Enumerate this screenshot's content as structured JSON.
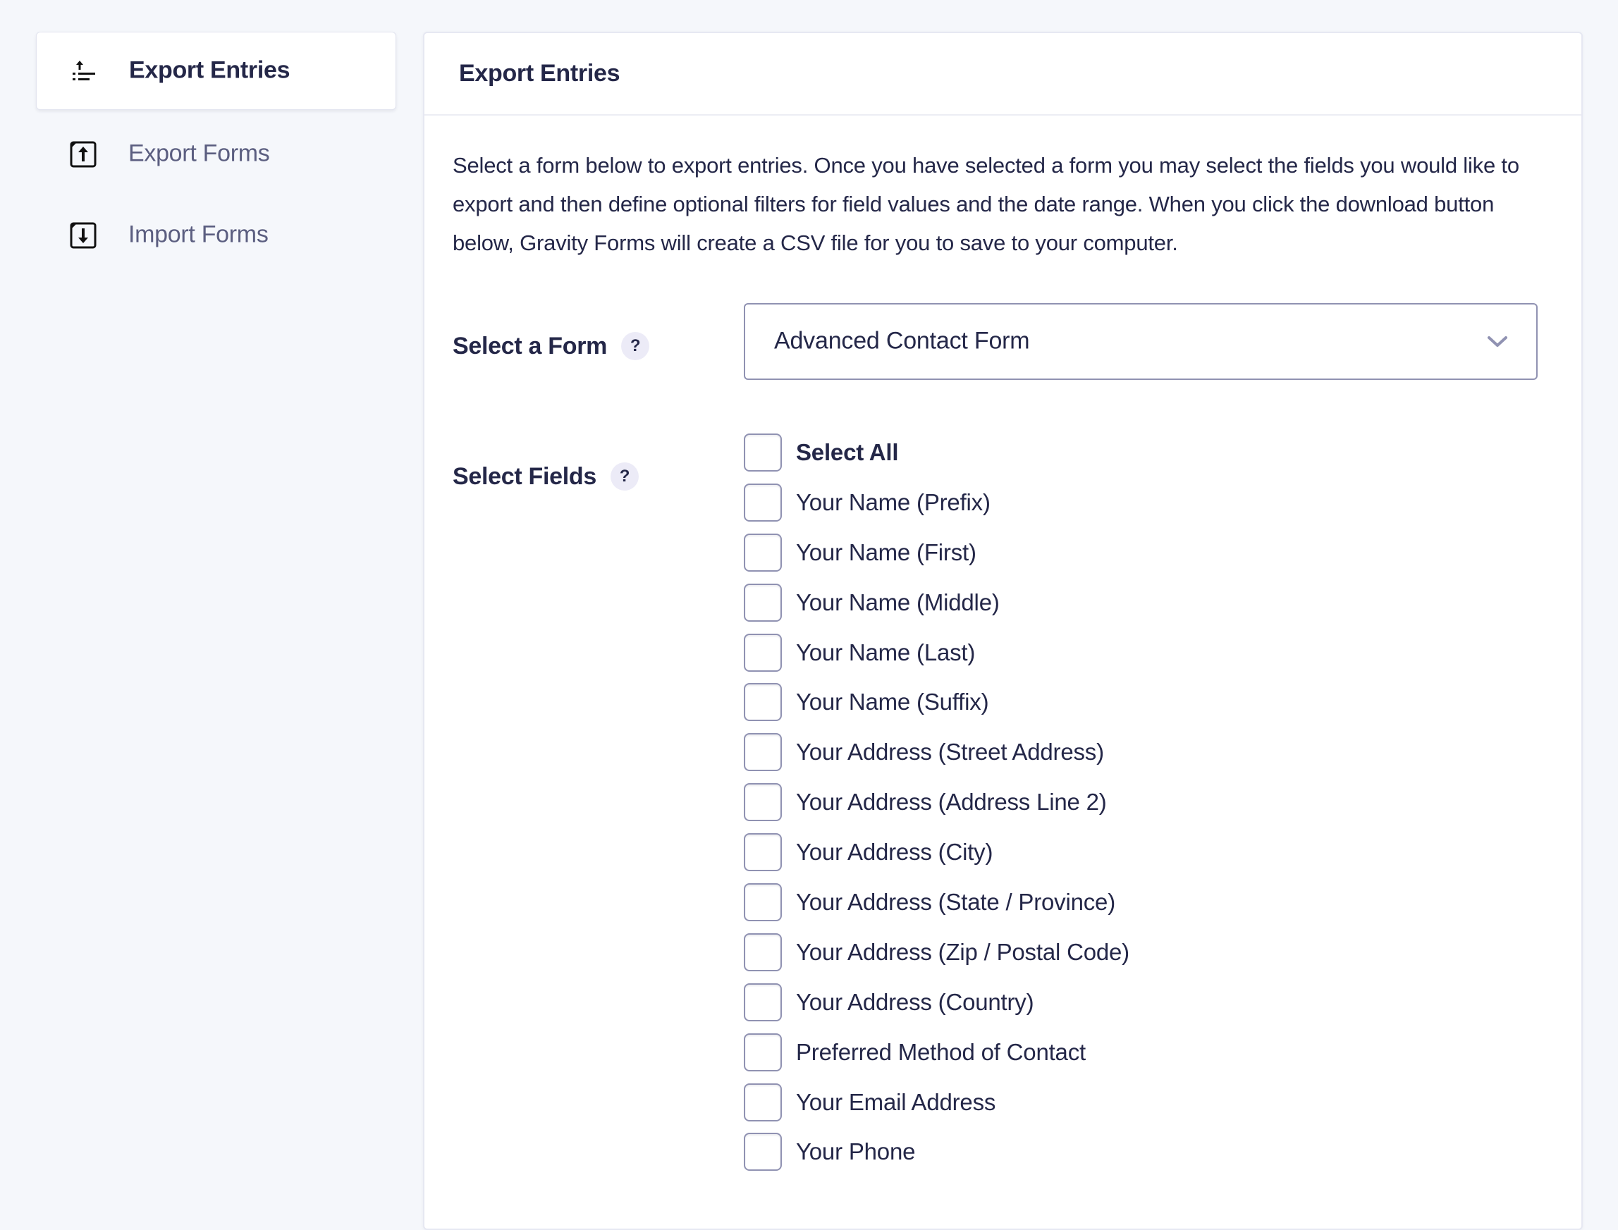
{
  "sidebar": {
    "items": [
      {
        "label": "Export Entries",
        "icon": "export-entries-icon",
        "active": true
      },
      {
        "label": "Export Forms",
        "icon": "export-forms-icon",
        "active": false
      },
      {
        "label": "Import Forms",
        "icon": "import-forms-icon",
        "active": false
      }
    ]
  },
  "card": {
    "title": "Export Entries",
    "description": "Select a form below to export entries. Once you have selected a form you may select the fields you would like to export and then define optional filters for field values and the date range. When you click the download button below, Gravity Forms will create a CSV file for you to save to your computer.",
    "select_form": {
      "label": "Select a Form",
      "help": "?",
      "value": "Advanced Contact Form"
    },
    "select_fields": {
      "label": "Select Fields",
      "help": "?",
      "select_all_label": "Select All",
      "fields": [
        {
          "label": "Your Name (Prefix)",
          "checked": false
        },
        {
          "label": "Your Name (First)",
          "checked": false
        },
        {
          "label": "Your Name (Middle)",
          "checked": false
        },
        {
          "label": "Your Name (Last)",
          "checked": false
        },
        {
          "label": "Your Name (Suffix)",
          "checked": false
        },
        {
          "label": "Your Address (Street Address)",
          "checked": false
        },
        {
          "label": "Your Address (Address Line 2)",
          "checked": false
        },
        {
          "label": "Your Address (City)",
          "checked": false
        },
        {
          "label": "Your Address (State / Province)",
          "checked": false
        },
        {
          "label": "Your Address (Zip / Postal Code)",
          "checked": false
        },
        {
          "label": "Your Address (Country)",
          "checked": false
        },
        {
          "label": "Preferred Method of Contact",
          "checked": false
        },
        {
          "label": "Your Email Address",
          "checked": false
        },
        {
          "label": "Your Phone",
          "checked": false
        }
      ]
    }
  },
  "colors": {
    "page_background": "#f5f7fb",
    "text_primary": "#242748",
    "text_muted": "#5b5e80",
    "control_border": "#9092b2",
    "help_badge_bg": "#ecebf7"
  }
}
